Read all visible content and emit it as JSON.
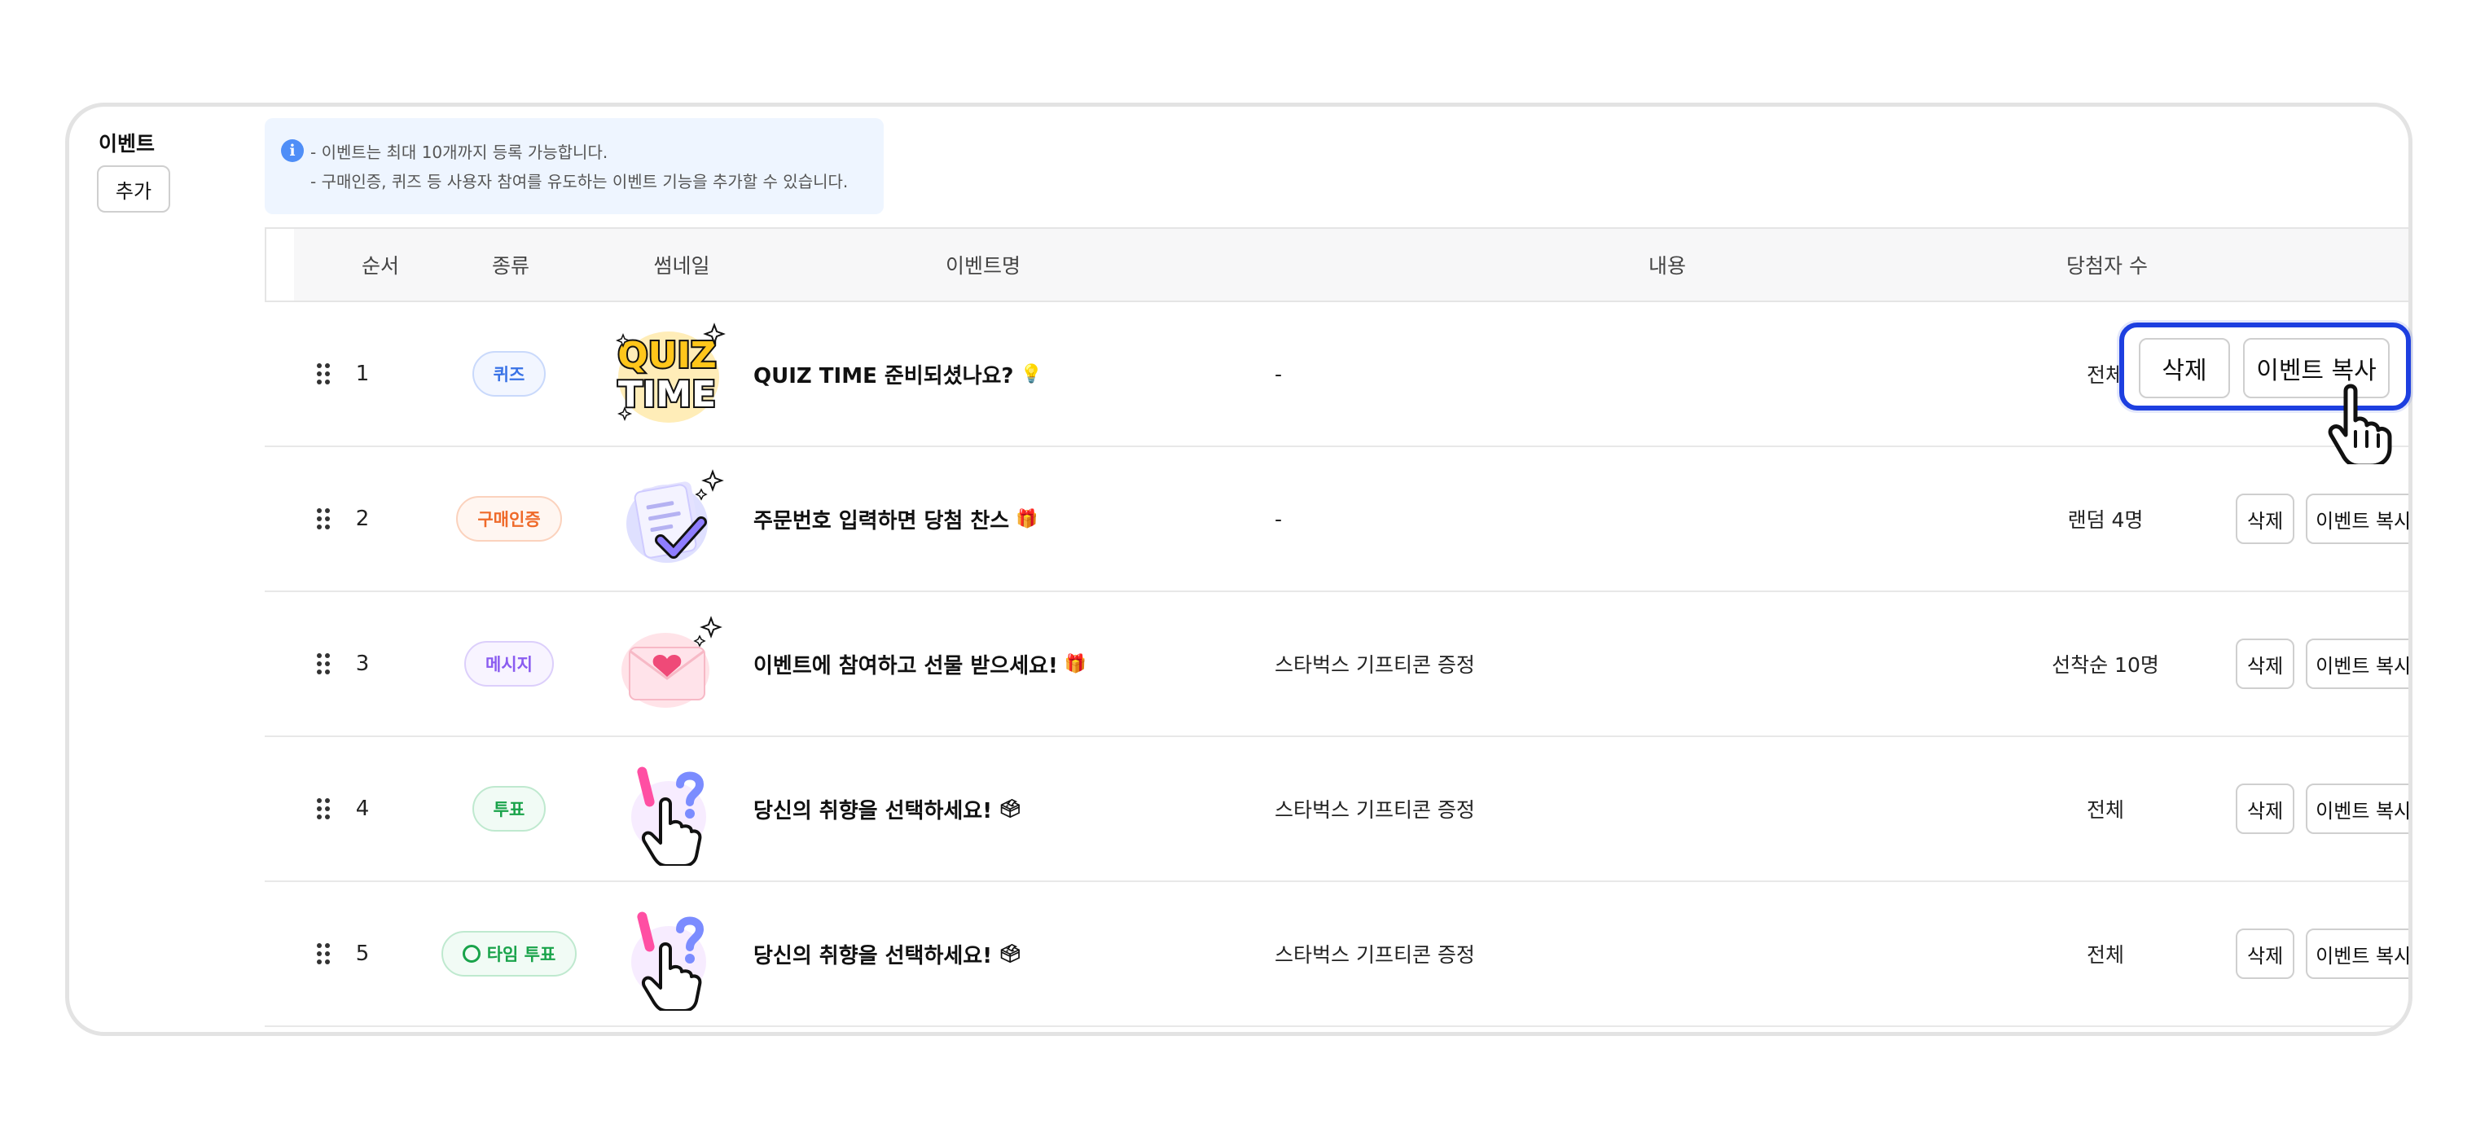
{
  "section": {
    "title": "이벤트",
    "add_label": "추가"
  },
  "notice": {
    "icon": "info-icon",
    "line1": "- 이벤트는 최대 10개까지 등록 가능합니다.",
    "line2": "- 구매인증, 퀴즈 등 사용자 참여를 유도하는 이벤트 기능을 추가할 수 있습니다."
  },
  "table": {
    "columns": [
      "순서",
      "종류",
      "썸네일",
      "이벤트명",
      "내용",
      "당첨자 수"
    ],
    "rows": [
      {
        "order": "1",
        "kind": "퀴즈",
        "title": "QUIZ TIME 준비되셨나요?",
        "emoji": "💡",
        "content": "-",
        "winners": "전체",
        "delete": "삭제",
        "copy": "이벤트 복사"
      },
      {
        "order": "2",
        "kind": "구매인증",
        "title": "주문번호 입력하면 당첨 찬스",
        "emoji": "🎁",
        "content": "-",
        "winners": "랜덤 4명",
        "delete": "삭제",
        "copy": "이벤트 복사"
      },
      {
        "order": "3",
        "kind": "메시지",
        "title": "이벤트에 참여하고 선물 받으세요!",
        "emoji": "🎁",
        "content": "스타벅스 기프티콘 증정",
        "winners": "선착순 10명",
        "delete": "삭제",
        "copy": "이벤트 복사"
      },
      {
        "order": "4",
        "kind": "투표",
        "title": "당신의 취향을 선택하세요!",
        "emoji": "🗳",
        "content": "스타벅스 기프티콘 증정",
        "winners": "전체",
        "delete": "삭제",
        "copy": "이벤트 복사"
      },
      {
        "order": "5",
        "kind": "타임 투표",
        "title": "당신의 취향을 선택하세요!",
        "emoji": "🗳",
        "content": "스타벅스 기프티콘 증정",
        "winners": "전체",
        "delete": "삭제",
        "copy": "이벤트 복사"
      }
    ]
  },
  "colors": {
    "highlight": "#1d3fe0",
    "info": "#4f8ef7"
  }
}
